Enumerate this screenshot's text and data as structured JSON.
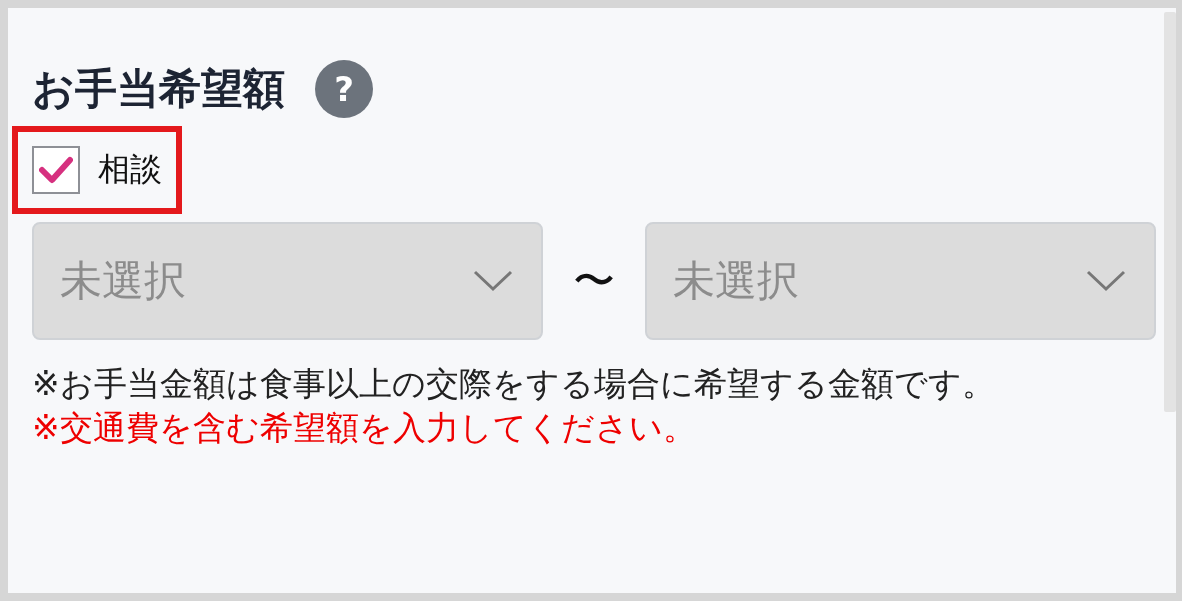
{
  "section": {
    "title": "お手当希望額",
    "help_icon": "?"
  },
  "consult": {
    "label": "相談",
    "checked": true,
    "highlighted": true
  },
  "range": {
    "from": {
      "value": "未選択",
      "disabled": true
    },
    "separator": "〜",
    "to": {
      "value": "未選択",
      "disabled": true
    }
  },
  "notes": [
    {
      "kind": "plain",
      "text": "※お手当金額は食事以上の交際をする場合に希望する金額です。"
    },
    {
      "kind": "warning",
      "text": "※交通費を含む希望額を入力してください。"
    }
  ]
}
